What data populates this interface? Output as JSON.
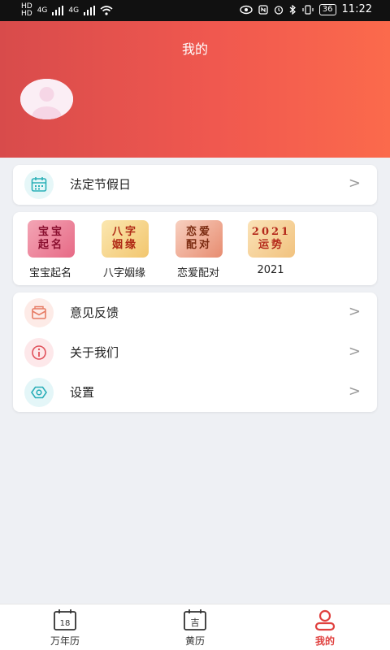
{
  "status_bar": {
    "left_badges": [
      "HD",
      "HD"
    ],
    "signal_1": "4G",
    "signal_2": "4G",
    "battery": "36",
    "time": "11:22"
  },
  "header": {
    "title": "我的",
    "gradient_start": "#d84b4b",
    "gradient_end": "#fb6a4c"
  },
  "holiday_row": {
    "label": "法定节假日",
    "icon": "calendar-icon",
    "chevron": ">"
  },
  "features": [
    {
      "label": "宝宝起名",
      "tile_line1": "宝宝",
      "tile_line2": "起名"
    },
    {
      "label": "八字姻缘",
      "tile_line1": "八字",
      "tile_line2": "姻缘"
    },
    {
      "label": "恋爱配对",
      "tile_line1": "恋爱",
      "tile_line2": "配对"
    },
    {
      "label": "2021",
      "tile_line1": "2021",
      "tile_line2": "运势"
    }
  ],
  "menu": [
    {
      "label": "意见反馈",
      "icon": "envelope-icon",
      "chevron": ">"
    },
    {
      "label": "关于我们",
      "icon": "info-icon",
      "chevron": ">"
    },
    {
      "label": "设置",
      "icon": "eye-settings-icon",
      "chevron": ">"
    }
  ],
  "tabs": [
    {
      "label": "万年历",
      "icon_text": "18",
      "icon": "calendar-date-icon"
    },
    {
      "label": "黄历",
      "icon_text": "吉",
      "icon": "almanac-icon"
    },
    {
      "label": "我的",
      "icon": "person-icon",
      "active": true
    }
  ],
  "colors": {
    "accent": "#e0413f",
    "background": "#eef0f4"
  }
}
